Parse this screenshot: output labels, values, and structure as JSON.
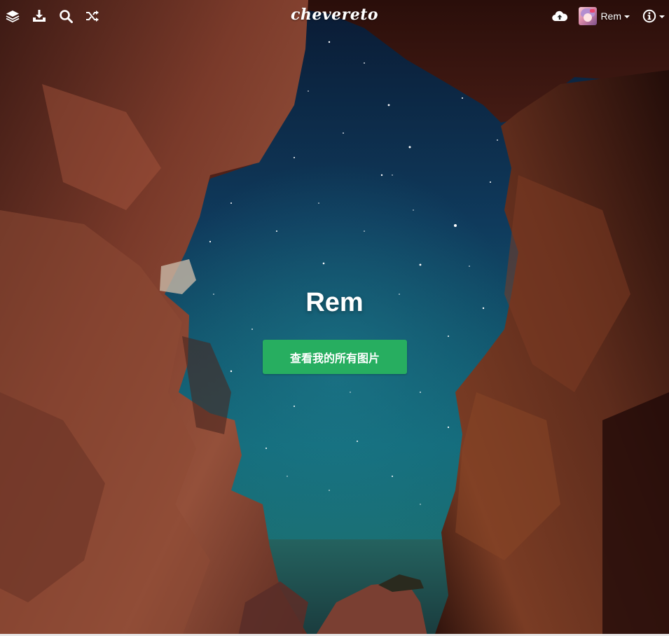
{
  "app": {
    "logo_text": "chevereto"
  },
  "topbar": {
    "left_icons": [
      {
        "name": "layers-icon",
        "label": "explore"
      },
      {
        "name": "download-tray-icon",
        "label": "upload"
      },
      {
        "name": "search-icon",
        "label": "search"
      },
      {
        "name": "shuffle-icon",
        "label": "random"
      }
    ],
    "upload_icon": "cloud-upload-icon",
    "user": {
      "name": "Rem"
    },
    "info_icon": "info-circle-icon"
  },
  "hero": {
    "title": "Rem",
    "button_label": "查看我的所有图片"
  },
  "colors": {
    "accent_button": "#27ae60",
    "text": "#ffffff"
  }
}
